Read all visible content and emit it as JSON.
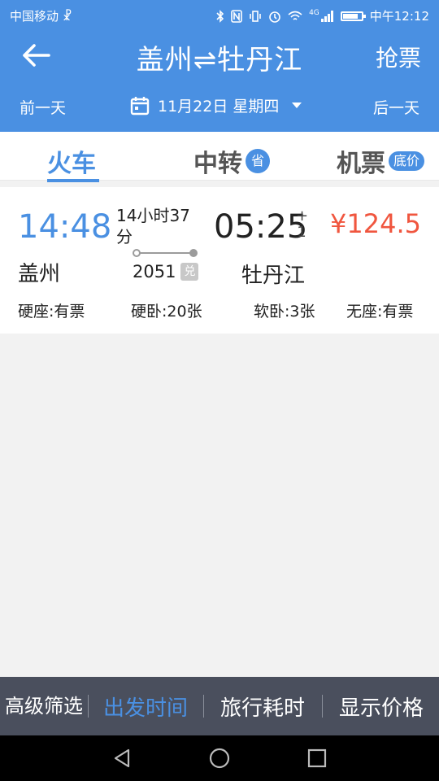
{
  "status_bar": {
    "carrier": "中国移动 ☧",
    "signal_label": "4G",
    "time": "中午12:12",
    "battery_level": 0.8
  },
  "header": {
    "title": "盖州⇌牡丹江",
    "grab_ticket": "抢票",
    "prev_day": "前一天",
    "next_day": "后一天",
    "date": "11月22日 星期四"
  },
  "tabs": [
    {
      "label": "火车",
      "badge": ""
    },
    {
      "label": "中转",
      "badge": "省"
    },
    {
      "label": "机票",
      "badge": "底价"
    }
  ],
  "train": {
    "dep_time": "14:48",
    "dep_station": "盖州",
    "duration": "14小时37分",
    "train_no": "2051",
    "redeem_mark": "兑",
    "arr_time": "05:25",
    "day_offset": "+1",
    "arr_station": "牡丹江",
    "price": "¥124.5",
    "seats": [
      "硬座:有票",
      "硬卧:20张",
      "软卧:3张",
      "无座:有票"
    ]
  },
  "bottom_bar": {
    "filter": "高级筛选",
    "departure_time": "出发时间",
    "travel_time": "旅行耗时",
    "show_price": "显示价格"
  },
  "colors": {
    "primary": "#4a90e2",
    "price": "#f0563f",
    "bottom_bar": "#4a4f5d"
  }
}
